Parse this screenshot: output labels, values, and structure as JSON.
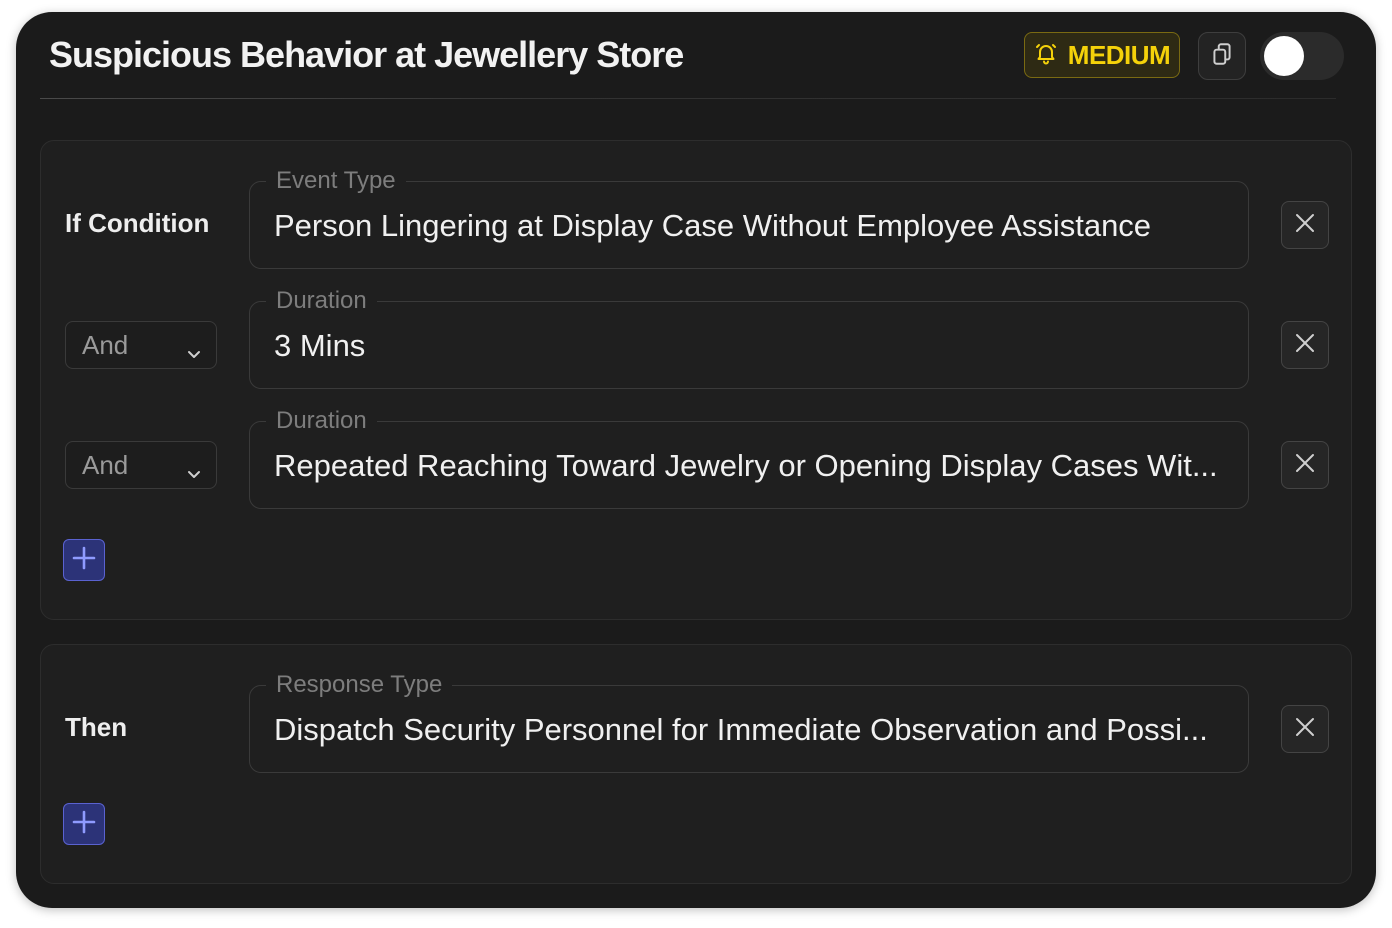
{
  "header": {
    "title": "Suspicious Behavior at Jewellery Store",
    "severity_badge": {
      "label": "MEDIUM",
      "icon": "bell-icon",
      "color": "#f5d20a"
    },
    "copy_icon": "copy-icon",
    "toggle": {
      "state": "off"
    }
  },
  "conditions": {
    "label": "If Condition",
    "rows": [
      {
        "connector": "",
        "field_label": "Event Type",
        "value": "Person Lingering at Display Case Without Employee Assistance"
      },
      {
        "connector": "And",
        "field_label": "Duration",
        "value": "3 Mins"
      },
      {
        "connector": "And",
        "field_label": "Duration",
        "value": "Repeated Reaching Toward Jewelry or Opening Display Cases Wit..."
      }
    ]
  },
  "then": {
    "label": "Then",
    "rows": [
      {
        "field_label": "Response Type",
        "value": "Dispatch Security Personnel for Immediate Observation and Possi..."
      }
    ]
  },
  "colors": {
    "background": "#1b1b1b",
    "accent_add": "#2c3378",
    "badge_text": "#f5d20a"
  }
}
